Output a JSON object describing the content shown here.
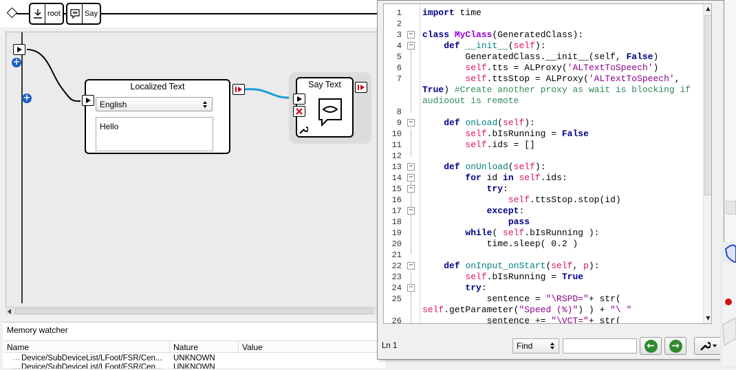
{
  "breadcrumb": {
    "items": [
      {
        "label": "root"
      },
      {
        "label": "Say"
      }
    ]
  },
  "boxes": {
    "localized_text": {
      "title": "Localized Text",
      "language": "English",
      "text": "Hello"
    },
    "say_text": {
      "title": "Say Text"
    }
  },
  "memory_watcher": {
    "title": "Memory watcher",
    "columns": [
      "Name",
      "Nature",
      "Value"
    ],
    "rows": [
      {
        "name": "Device/SubDeviceList/LFoot/FSR/Cen...",
        "nature": "UNKNOWN",
        "value": ""
      },
      {
        "name": "Device/SubDeviceList/LFoot/FSR/Cen...",
        "nature": "UNKNOWN",
        "value": ""
      }
    ]
  },
  "editor": {
    "status": "Ln 1",
    "find_label": "Find",
    "find_value": "",
    "line_numbers": [
      "1",
      "2",
      "3",
      "4",
      "5",
      "6",
      "7",
      "8",
      "9",
      "10",
      "11",
      "12",
      "13",
      "14",
      "15",
      "16",
      "17",
      "18",
      "19",
      "20",
      "21",
      "22",
      "23",
      "24",
      "25",
      "26"
    ]
  },
  "colors": {
    "wire": "#1e9ad6",
    "accent_blue": "#1a5fc9",
    "nav_green": "#2e8b2e"
  }
}
